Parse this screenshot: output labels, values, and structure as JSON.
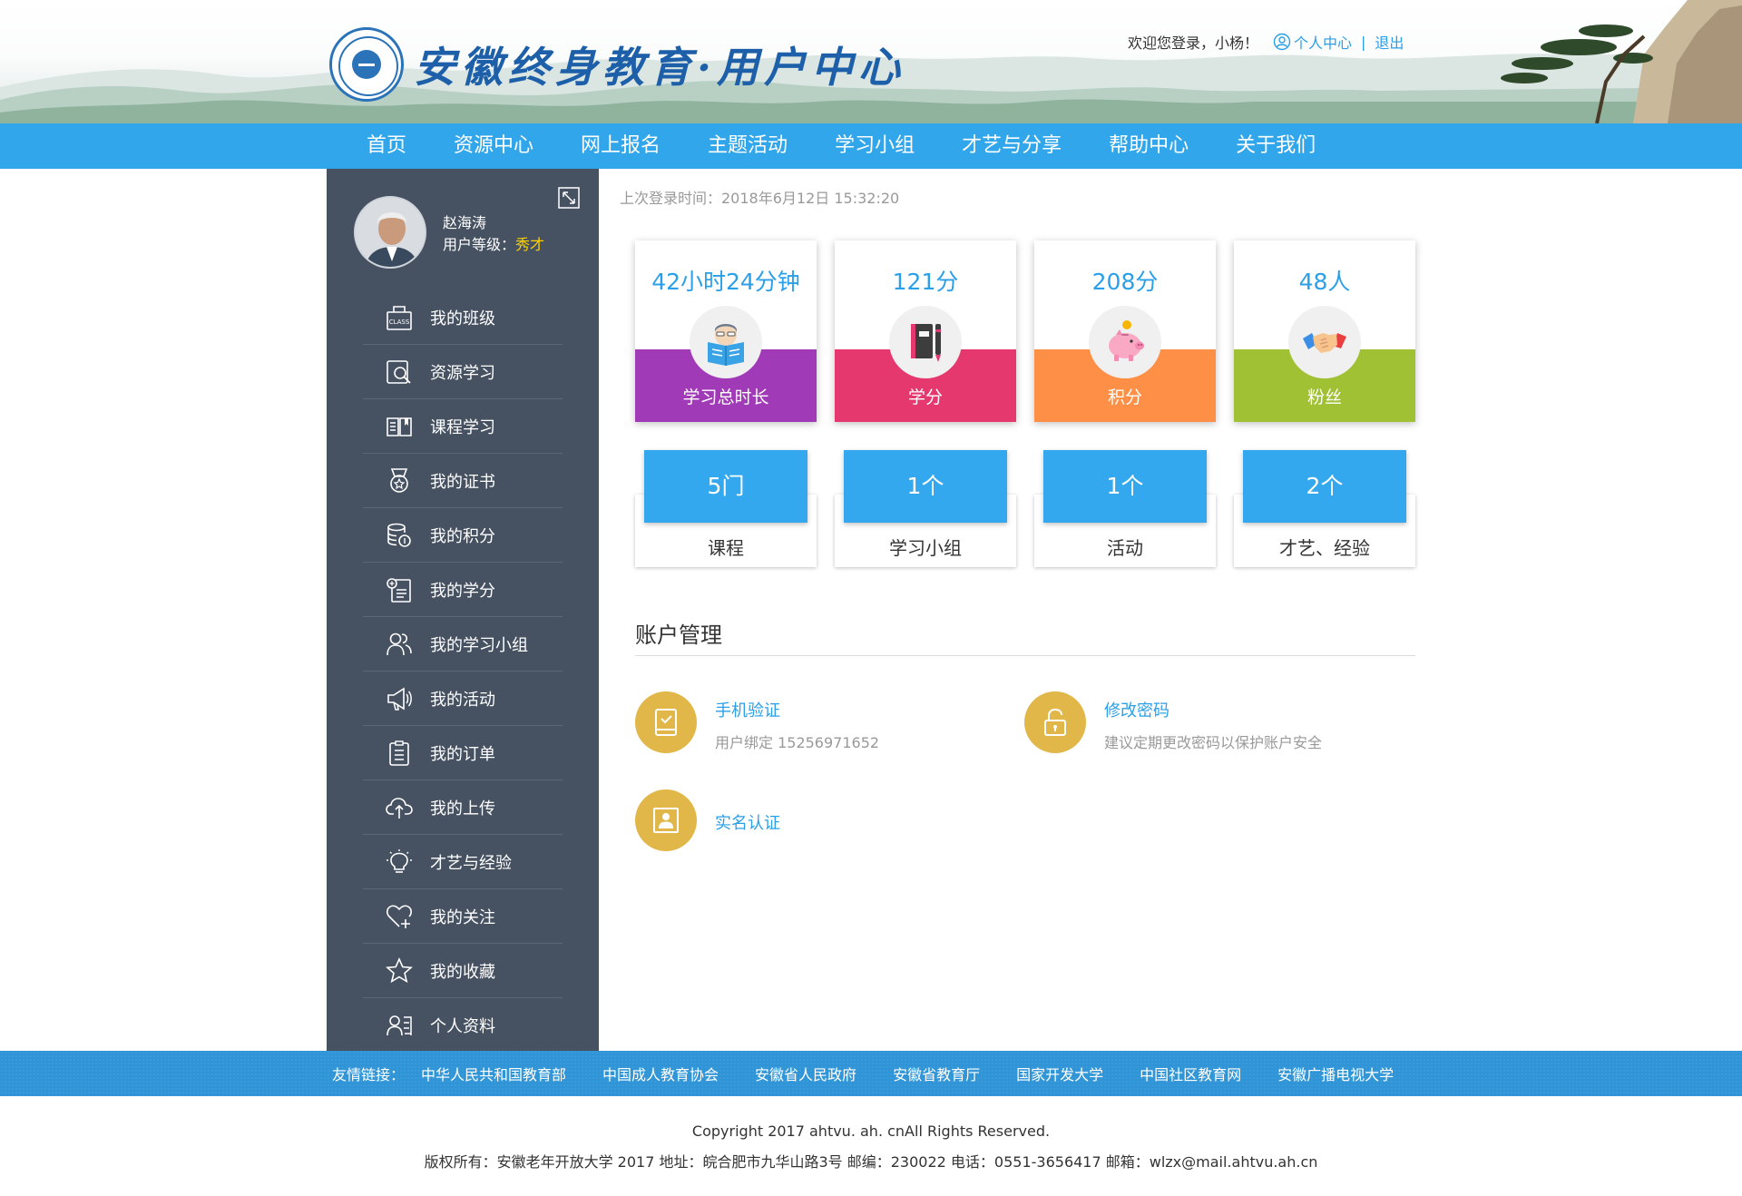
{
  "header": {
    "site_title": "安徽终身教育·用户中心",
    "welcome": "欢迎您登录，小杨！",
    "user_center": "个人中心",
    "separator": "|",
    "logout": "退出"
  },
  "nav": {
    "items": [
      "首页",
      "资源中心",
      "网上报名",
      "主题活动",
      "学习小组",
      "才艺与分享",
      "帮助中心",
      "关于我们"
    ]
  },
  "profile": {
    "name": "赵海涛",
    "level_label": "用户等级：",
    "level_value": "秀才"
  },
  "sidebar": {
    "items": [
      {
        "label": "我的班级",
        "icon": "class-icon"
      },
      {
        "label": "资源学习",
        "icon": "search-doc-icon"
      },
      {
        "label": "课程学习",
        "icon": "book-icon"
      },
      {
        "label": "我的证书",
        "icon": "medal-icon"
      },
      {
        "label": "我的积分",
        "icon": "coins-icon"
      },
      {
        "label": "我的学分",
        "icon": "credit-doc-icon"
      },
      {
        "label": "我的学习小组",
        "icon": "group-icon"
      },
      {
        "label": "我的活动",
        "icon": "megaphone-icon"
      },
      {
        "label": "我的订单",
        "icon": "order-icon"
      },
      {
        "label": "我的上传",
        "icon": "cloud-upload-icon"
      },
      {
        "label": "才艺与经验",
        "icon": "bulb-icon"
      },
      {
        "label": "我的关注",
        "icon": "heart-plus-icon"
      },
      {
        "label": "我的收藏",
        "icon": "star-icon"
      },
      {
        "label": "个人资料",
        "icon": "profile-icon"
      }
    ]
  },
  "main": {
    "last_login": "上次登录时间：2018年6月12日  15:32:20",
    "stats": [
      {
        "value": "42小时24分钟",
        "label": "学习总时长",
        "color": "#a03ab6",
        "icon": "reading-icon"
      },
      {
        "value": "121分",
        "label": "学分",
        "color": "#e5386f",
        "icon": "notebook-pen-icon"
      },
      {
        "value": "208分",
        "label": "积分",
        "color": "#fd9046",
        "icon": "piggy-bank-icon"
      },
      {
        "value": "48人",
        "label": "粉丝",
        "color": "#a1c134",
        "icon": "handshake-icon"
      }
    ],
    "counts": [
      {
        "value": "5门",
        "label": "课程"
      },
      {
        "value": "1个",
        "label": "学习小组"
      },
      {
        "value": "1个",
        "label": "活动"
      },
      {
        "value": "2个",
        "label": "才艺、经验"
      }
    ],
    "account": {
      "title": "账户管理",
      "phone": {
        "title": "手机验证",
        "desc": "用户绑定  15256971652",
        "icon": "phone-verify-icon"
      },
      "password": {
        "title": "修改密码",
        "desc": "建议定期更改密码以保护账户安全",
        "icon": "lock-icon"
      },
      "realname": {
        "title": "实名认证",
        "icon": "id-card-icon"
      }
    }
  },
  "footer": {
    "links_label": "友情链接：",
    "links": [
      "中华人民共和国教育部",
      "中国成人教育协会",
      "安徽省人民政府",
      "安徽省教育厅",
      "国家开发大学",
      "中国社区教育网",
      "安徽广播电视大学"
    ],
    "copyright": "Copyright 2017 ahtvu. ah. cnAll Rights Reserved.",
    "address": "版权所有：安徽老年开放大学 2017 地址：皖合肥市九华山路3号 邮编：230022 电话：0551-3656417 邮箱：wlzx@mail.ahtvu.ah.cn"
  },
  "colors": {
    "nav": "#32a6ea",
    "sidebar": "#465161",
    "accent": "#2b9fe8",
    "gold": "#e2b74a"
  }
}
